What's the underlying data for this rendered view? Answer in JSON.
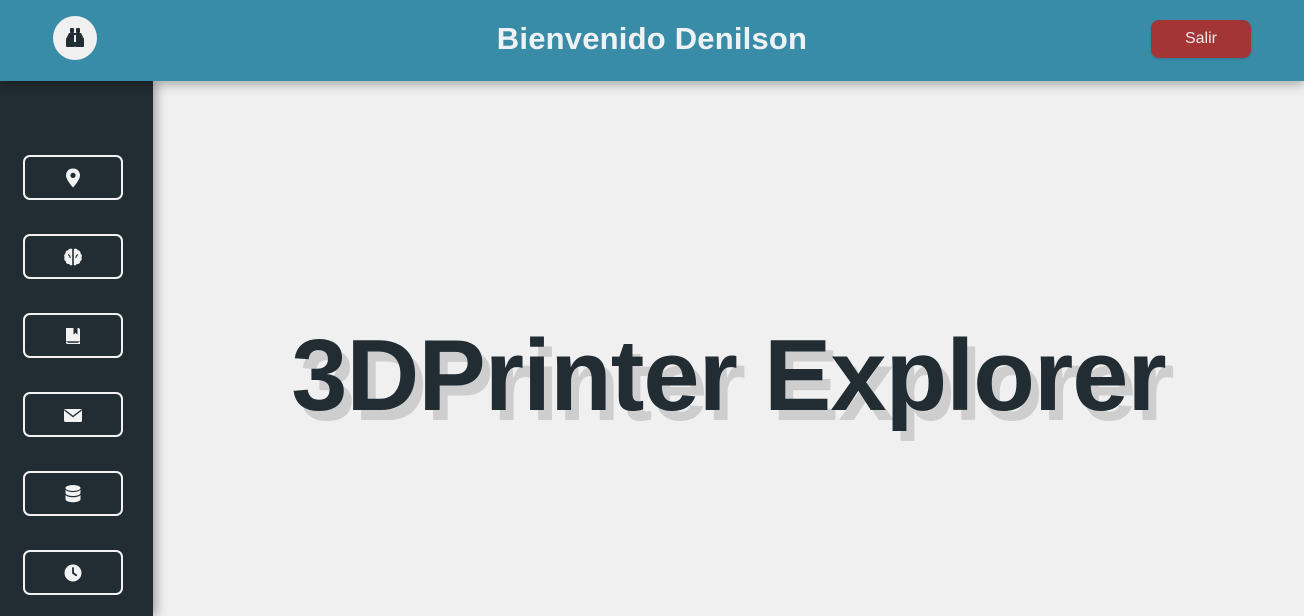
{
  "header": {
    "title": "Bienvenido Denilson",
    "logout_label": "Salir",
    "logo_icon": "binoculars-icon"
  },
  "sidebar": {
    "items": [
      {
        "icon": "map-marker-icon"
      },
      {
        "icon": "brain-icon"
      },
      {
        "icon": "book-bookmark-icon"
      },
      {
        "icon": "envelope-icon"
      },
      {
        "icon": "database-icon"
      },
      {
        "icon": "clock-icon"
      }
    ]
  },
  "main": {
    "hero_title": "3DPrinter Explorer"
  },
  "colors": {
    "header_bg": "#388ca7",
    "sidebar_bg": "#212d33",
    "logout_bg": "#a33537",
    "main_bg": "#f0f0f0",
    "hero_text": "#212d33"
  }
}
